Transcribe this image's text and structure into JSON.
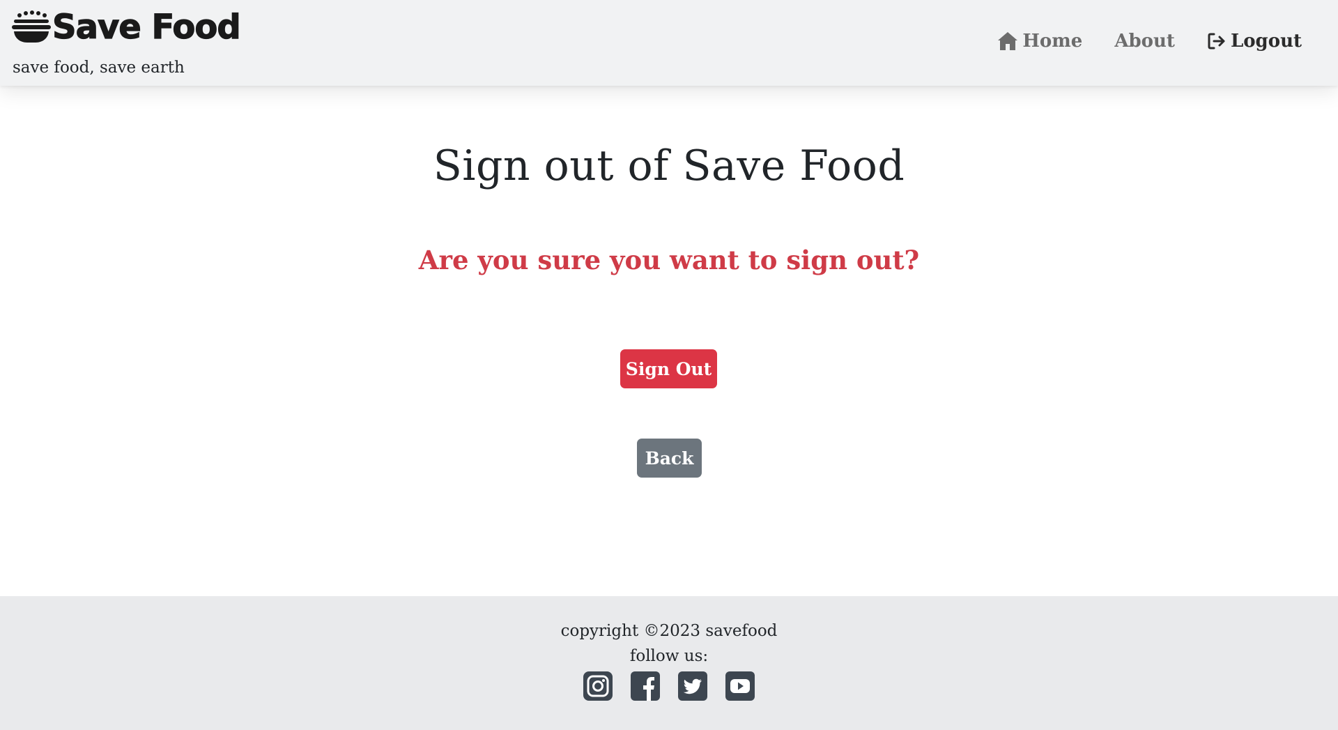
{
  "header": {
    "brand_name": "Save Food",
    "brand_icon": "food-bowl-icon",
    "tagline": "save food, save earth",
    "nav": [
      {
        "label": "Home",
        "icon": "home-icon"
      },
      {
        "label": "About"
      },
      {
        "label": "Logout",
        "icon": "sign-out-icon",
        "active": true
      }
    ]
  },
  "main": {
    "title": "Sign out of Save Food",
    "question": "Are you sure you want to sign out?",
    "signout_label": "Sign Out",
    "back_label": "Back"
  },
  "footer": {
    "copyright": "copyright ©2023 savefood",
    "follow": "follow us:",
    "socials": [
      "instagram-icon",
      "facebook-icon",
      "twitter-icon",
      "youtube-icon"
    ]
  },
  "colors": {
    "danger": "#dc3545",
    "secondary": "#6c757d",
    "question_text": "#cf3b47",
    "header_bg": "#f1f2f3",
    "footer_bg": "#e9eaec"
  }
}
